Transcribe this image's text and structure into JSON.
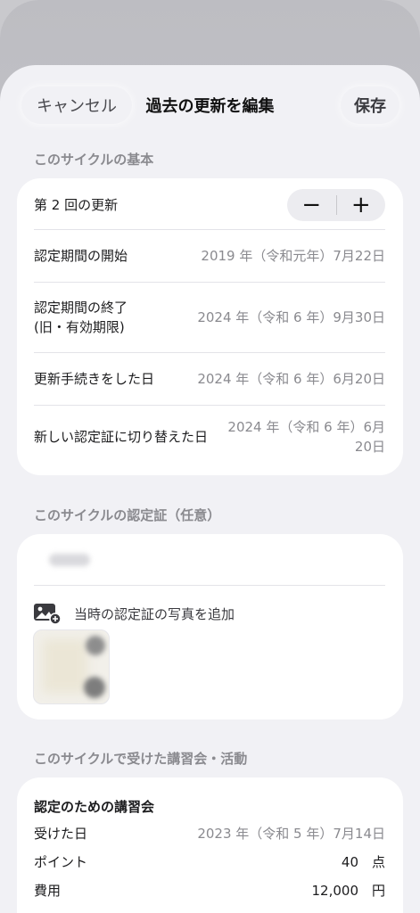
{
  "nav": {
    "cancel_label": "キャンセル",
    "title": "過去の更新を編集",
    "save_label": "保存"
  },
  "basics": {
    "header": "このサイクルの基本",
    "renewal_label": "第 2 回の更新",
    "stepper_minus": "−",
    "stepper_plus": "+",
    "rows": [
      {
        "label": "認定期間の開始",
        "value": "2019 年（令和元年）7月22日"
      },
      {
        "label": "認定期間の終了",
        "label2": "(旧・有効期限)",
        "value": "2024 年（令和 6 年）9月30日"
      },
      {
        "label": "更新手続きをした日",
        "value": "2024 年（令和 6 年）6月20日"
      },
      {
        "label": "新しい認定証に切り替えた日",
        "value": "2024 年（令和 6 年）6月",
        "value2": "20日"
      }
    ]
  },
  "certificate": {
    "header": "このサイクルの認定証（任意）",
    "add_photo_label": "当時の認定証の写真を追加",
    "icon": "photo-add-icon"
  },
  "activities": {
    "header": "このサイクルで受けた講習会・活動",
    "lecture_title": "認定のための講習会",
    "rows": [
      {
        "label": "受けた日",
        "value": "2023 年（令和 5 年）7月14日"
      },
      {
        "label": "ポイント",
        "value": "40　点"
      },
      {
        "label": "費用",
        "value": "12,000　円"
      }
    ]
  }
}
